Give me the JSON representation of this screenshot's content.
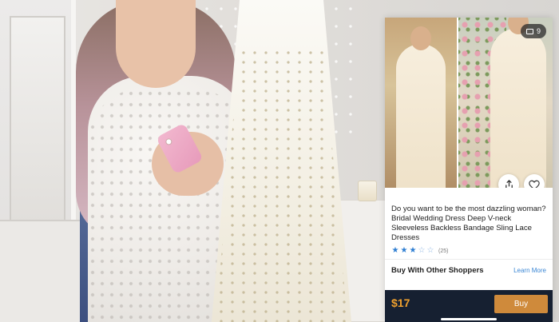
{
  "video_scene": {
    "description_icons": [
      "phone-icon"
    ]
  },
  "product_card": {
    "image_count": "9",
    "title": "Do you want to be the most dazzling woman? Bridal Wedding Dress Deep V-neck Sleeveless Backless Bandage Sling Lace Dresses",
    "rating": {
      "stars_filled": 3,
      "stars_total": 5,
      "count_label": "(25)"
    },
    "section_title": "Buy With Other Shoppers",
    "learn_more_label": "Learn More",
    "price": "$17",
    "buy_label": "Buy",
    "icons": {
      "gallery_count": "image-stack-icon",
      "share": "share-icon",
      "like": "heart-icon",
      "star": "star-icon"
    },
    "colors": {
      "price": "#f0a12e",
      "buy_button": "#cf8a3b",
      "footer": "#162031",
      "star": "#2d7dd2",
      "link": "#3a86d4"
    }
  }
}
